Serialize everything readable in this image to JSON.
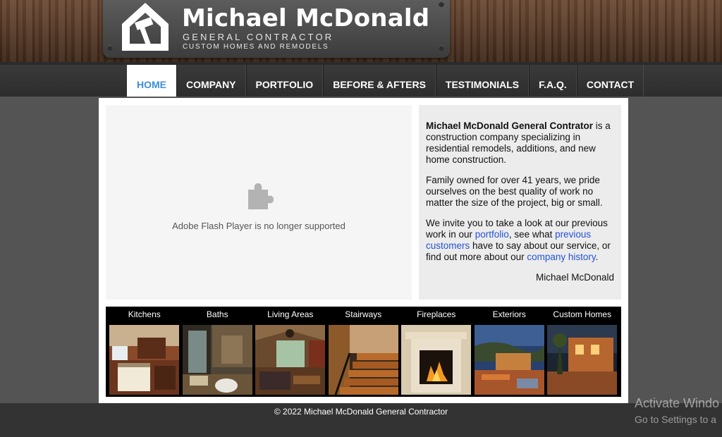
{
  "header": {
    "company_name": "Michael McDonald",
    "tagline_1": "GENERAL CONTRACTOR",
    "tagline_2": "CUSTOM HOMES AND REMODELS",
    "logo_icon": "house-hammer-icon"
  },
  "nav": {
    "items": [
      {
        "label": "HOME",
        "active": true
      },
      {
        "label": "COMPANY"
      },
      {
        "label": "PORTFOLIO"
      },
      {
        "label": "BEFORE & AFTERS"
      },
      {
        "label": "TESTIMONIALS"
      },
      {
        "label": "F.A.Q."
      },
      {
        "label": "CONTACT"
      }
    ],
    "active_color": "#3d8fd6"
  },
  "flash": {
    "icon": "puzzle-piece-icon",
    "message": "Adobe Flash Player is no longer supported"
  },
  "intro": {
    "p1_strong": "Michael McDonald General Contrator",
    "p1_rest": " is a construction company specializing in residential remodels, additions, and new home construction.",
    "p2": "Family owned for over 41 years, we pride ourselves on the best quality of work no matter the size of the project, big or small.",
    "p3_a": "We invite you to take a look at our previous work in our ",
    "p3_link1": "portfolio",
    "p3_b": ", see what ",
    "p3_link2": "previous customers",
    "p3_c": " have to say about our service, or find out more about our ",
    "p3_link3": "company history",
    "p3_d": ".",
    "signature": "Michael McDonald",
    "link_color": "#2352d8"
  },
  "gallery": {
    "tiles": [
      {
        "label": "Kitchens"
      },
      {
        "label": "Baths"
      },
      {
        "label": "Living Areas"
      },
      {
        "label": "Stairways"
      },
      {
        "label": "Fireplaces"
      },
      {
        "label": "Exteriors"
      },
      {
        "label": "Custom Homes"
      }
    ]
  },
  "footer": {
    "copyright": "© 2022 Michael McDonald General Contractor"
  },
  "os_overlay": {
    "title": "Activate Windo",
    "subtitle": "Go to Settings to a"
  }
}
